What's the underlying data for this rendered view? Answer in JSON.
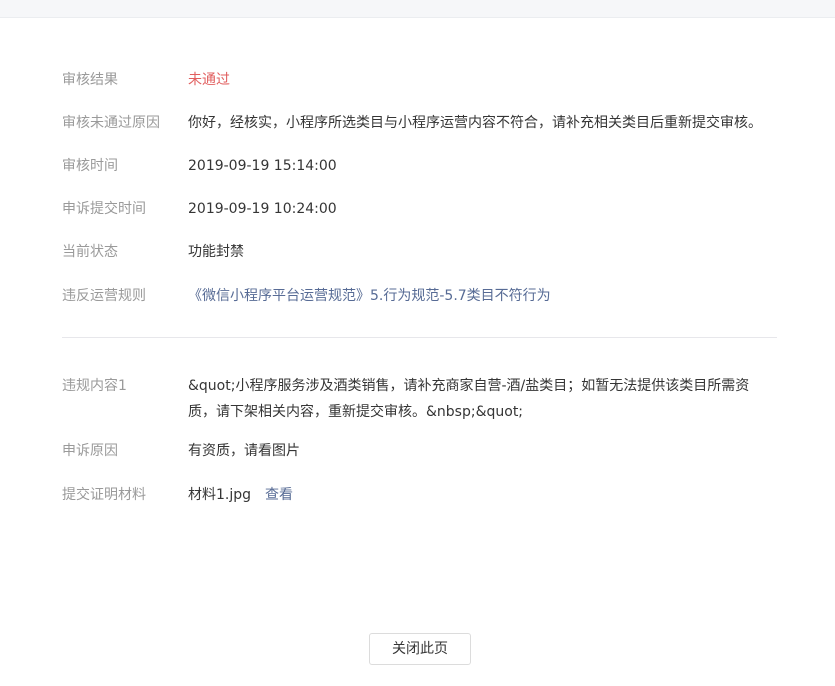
{
  "review": {
    "result": {
      "label": "审核结果",
      "value": "未通过"
    },
    "reject_reason": {
      "label": "审核未通过原因",
      "value": "你好，经核实，小程序所选类目与小程序运营内容不符合，请补充相关类目后重新提交审核。"
    },
    "review_time": {
      "label": "审核时间",
      "value": "2019-09-19 15:14:00"
    },
    "appeal_time": {
      "label": "申诉提交时间",
      "value": "2019-09-19 10:24:00"
    },
    "current_status": {
      "label": "当前状态",
      "value": "功能封禁"
    },
    "violated_rule": {
      "label": "违反运营规则",
      "link": "《微信小程序平台运营规范》",
      "value": "5.行为规范-5.7类目不符行为"
    }
  },
  "appeal": {
    "violation_content": {
      "label": "违规内容1",
      "value": "&quot;小程序服务涉及酒类销售，请补充商家自营-酒/盐类目；如暂无法提供该类目所需资质，请下架相关内容，重新提交审核。&nbsp;&quot;"
    },
    "appeal_reason": {
      "label": "申诉原因",
      "value": "有资质，请看图片"
    },
    "evidence": {
      "label": "提交证明材料",
      "file_name": "材料1.jpg",
      "view_label": "查看"
    }
  },
  "footer": {
    "close_label": "关闭此页"
  },
  "colors": {
    "fail": "#e15f5f",
    "link": "#576b95",
    "label": "#9a9a9a"
  }
}
